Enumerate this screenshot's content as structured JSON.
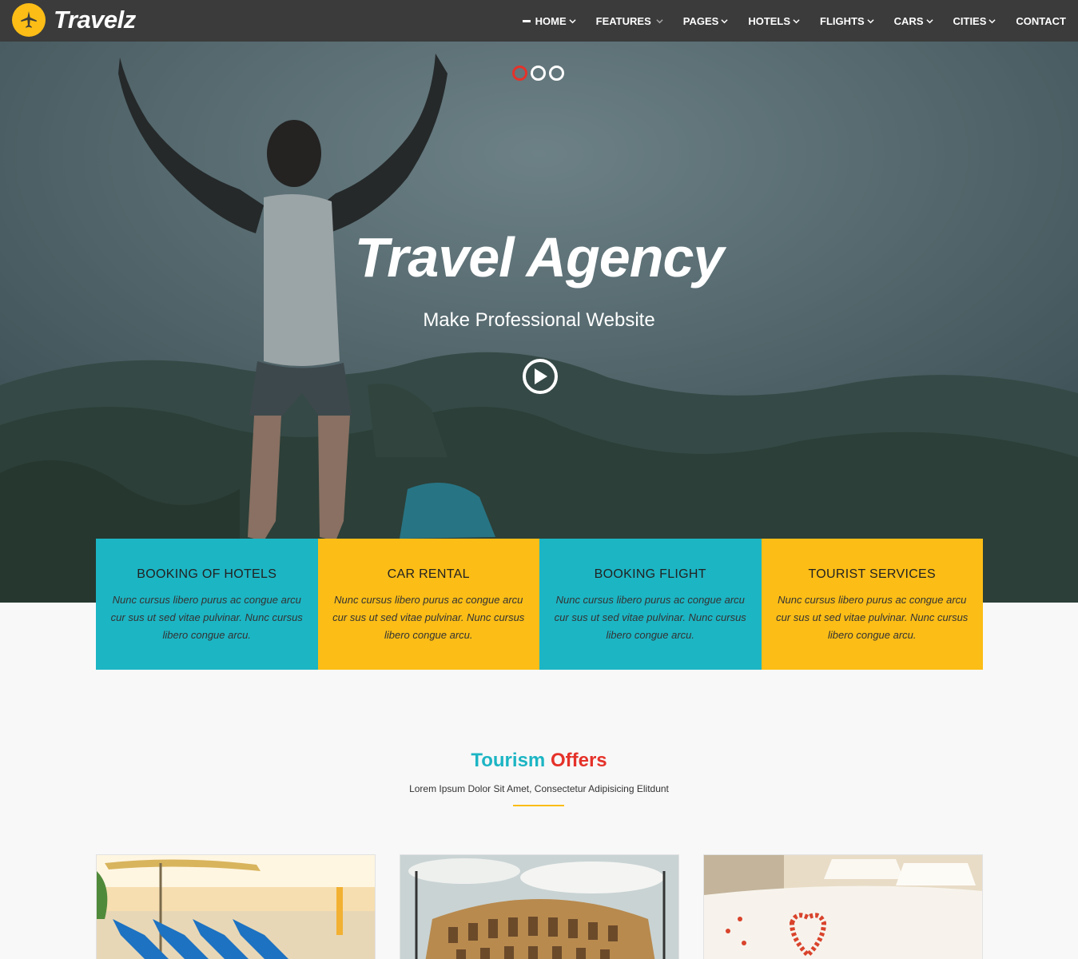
{
  "brand": {
    "name": "Travelz",
    "accent": "#fbbd16",
    "icon": "airplane-icon"
  },
  "nav": {
    "items": [
      {
        "label": "HOME",
        "has_dropdown": true,
        "active": true
      },
      {
        "label": "FEATURES",
        "has_dropdown": true
      },
      {
        "label": "PAGES",
        "has_dropdown": true
      },
      {
        "label": "HOTELS",
        "has_dropdown": true
      },
      {
        "label": "FLIGHTS",
        "has_dropdown": true
      },
      {
        "label": "CARS",
        "has_dropdown": true
      },
      {
        "label": "CITIES",
        "has_dropdown": true
      },
      {
        "label": "CONTACT",
        "has_dropdown": false
      }
    ]
  },
  "hero": {
    "title": "Travel Agency",
    "subtitle": "Make Professional Website",
    "slides": 3,
    "active_slide": 1,
    "play_icon": "play-icon"
  },
  "services": [
    {
      "title": "BOOKING OF HOTELS",
      "text": "Nunc cursus libero purus ac congue arcu cur sus ut sed vitae pulvinar. Nunc cursus libero congue arcu.",
      "color": "#1cb5c4"
    },
    {
      "title": "CAR RENTAL",
      "text": "Nunc cursus libero purus ac congue arcu cur sus ut sed vitae pulvinar. Nunc cursus libero congue arcu.",
      "color": "#fbbd16"
    },
    {
      "title": "BOOKING FLIGHT",
      "text": "Nunc cursus libero purus ac congue arcu cur sus ut sed vitae pulvinar. Nunc cursus libero congue arcu.",
      "color": "#1cb5c4"
    },
    {
      "title": "TOURIST SERVICES",
      "text": "Nunc cursus libero purus ac congue arcu cur sus ut sed vitae pulvinar. Nunc cursus libero congue arcu.",
      "color": "#fbbd16"
    }
  ],
  "offers": {
    "title_part1": "Tourism",
    "title_part2": "Offers",
    "subtitle": "Lorem Ipsum Dolor Sit Amet, Consectetur Adipisicing Elitdunt"
  },
  "colors": {
    "teal": "#1cb5c4",
    "yellow": "#fbbd16",
    "red": "#e5322a",
    "nav_bg": "#3b3b3b"
  }
}
